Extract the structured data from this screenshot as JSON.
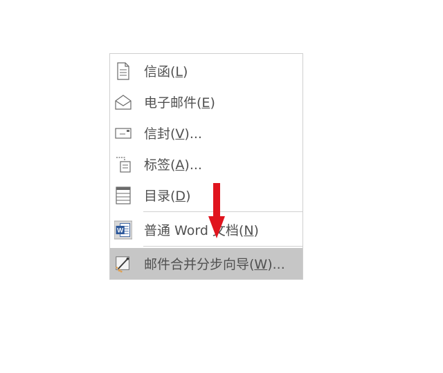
{
  "menu": {
    "items": [
      {
        "text": "信函(",
        "key": "L",
        "suffix": ")"
      },
      {
        "text": "电子邮件(",
        "key": "E",
        "suffix": ")"
      },
      {
        "text": "信封(",
        "key": "V",
        "suffix": ")..."
      },
      {
        "text": "标签(",
        "key": "A",
        "suffix": ")..."
      },
      {
        "text": "目录(",
        "key": "D",
        "suffix": ")"
      },
      {
        "text": "普通 Word 文档(",
        "key": "N",
        "suffix": ")"
      },
      {
        "text": "邮件合并分步向导(",
        "key": "W",
        "suffix": ")..."
      }
    ],
    "icons": [
      "letter-icon",
      "email-icon",
      "envelope-icon",
      "labels-icon",
      "directory-icon",
      "word-document-icon",
      "mail-merge-wizard-icon"
    ],
    "highlighted_index": 6
  },
  "colors": {
    "highlight": "#c6c6c6",
    "text": "#505050",
    "arrow": "#e0141e",
    "word_blue": "#2b579a"
  }
}
